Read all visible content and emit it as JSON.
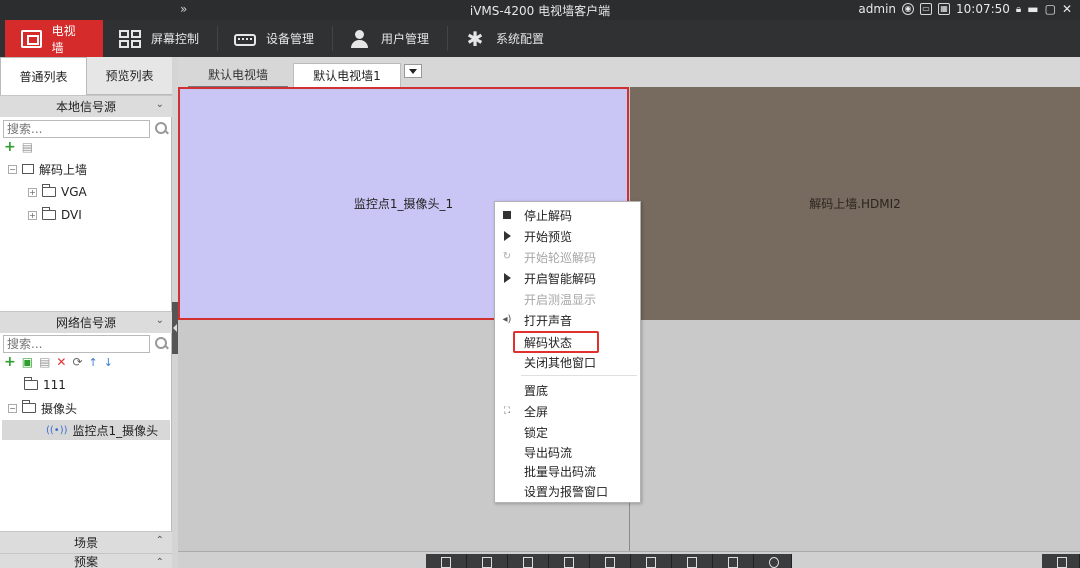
{
  "titlebar": {
    "expand_glyph": "»",
    "app_title": "iVMS-4200 电视墙客户端",
    "user": "admin",
    "clock": "10:07:50"
  },
  "menubar": {
    "items": [
      {
        "label": "电视墙",
        "icon": "tv-wall-icon",
        "active": true
      },
      {
        "label": "屏幕控制",
        "icon": "screen-grid-icon"
      },
      {
        "label": "设备管理",
        "icon": "device-icon"
      },
      {
        "label": "用户管理",
        "icon": "user-icon"
      },
      {
        "label": "系统配置",
        "icon": "gear-icon"
      }
    ]
  },
  "left_panel": {
    "tabs": [
      "普通列表",
      "预览列表"
    ],
    "local_source": {
      "title": "本地信号源",
      "search_placeholder": "搜索...",
      "tree": {
        "root": "解码上墙",
        "children": [
          "VGA",
          "DVI"
        ]
      }
    },
    "network_source": {
      "title": "网络信号源",
      "search_placeholder": "搜索...",
      "tree": {
        "group1": "111",
        "group2": "摄像头",
        "camera": "监控点1_摄像头"
      }
    },
    "scene": "场景",
    "plan": "预案"
  },
  "main": {
    "tabs": [
      "默认电视墙",
      "默认电视墙1"
    ],
    "cells": {
      "c1": "监控点1_摄像头_1",
      "c2": "解码上墙.HDMI2"
    }
  },
  "context_menu": {
    "items": [
      {
        "label": "停止解码",
        "icon": "stop-icon",
        "enabled": true
      },
      {
        "label": "开始预览",
        "icon": "play-icon",
        "enabled": true
      },
      {
        "label": "开始轮巡解码",
        "icon": "cycle-icon",
        "enabled": false
      },
      {
        "label": "开启智能解码",
        "icon": "play-icon",
        "enabled": true
      },
      {
        "label": "开启测温显示",
        "icon": "",
        "enabled": false
      },
      {
        "label": "打开声音",
        "icon": "speaker-icon",
        "enabled": true
      },
      {
        "label": "解码状态",
        "icon": "",
        "enabled": true,
        "highlighted": true
      },
      {
        "label": "关闭其他窗口",
        "icon": "",
        "enabled": true
      },
      {
        "label": "置底",
        "icon": "",
        "enabled": true
      },
      {
        "label": "全屏",
        "icon": "fullscreen-icon",
        "enabled": true
      },
      {
        "label": "锁定",
        "icon": "",
        "enabled": true
      },
      {
        "label": "导出码流",
        "icon": "",
        "enabled": true
      },
      {
        "label": "批量导出码流",
        "icon": "",
        "enabled": true
      },
      {
        "label": "设置为报警窗口",
        "icon": "",
        "enabled": true
      }
    ]
  },
  "colors": {
    "accent_red": "#d52b2b",
    "selected_cell": "#c9c6f6",
    "hdmi_cell": "#776a5e"
  }
}
